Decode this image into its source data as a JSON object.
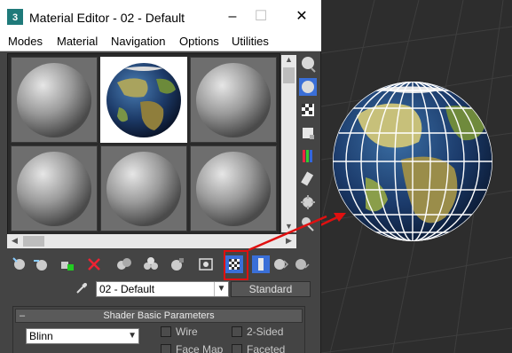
{
  "window": {
    "title": "Material Editor - 02 - Default",
    "controls": {
      "minimize": "–",
      "maximize": "☐",
      "close": "✕"
    }
  },
  "menu": {
    "items": [
      "Modes",
      "Material",
      "Navigation",
      "Options",
      "Utilities"
    ]
  },
  "slots": {
    "count": 6,
    "selected_index": 1,
    "selected_material": "earth-globe"
  },
  "name_row": {
    "material_name": "02 - Default",
    "material_type": "Standard"
  },
  "rollout": {
    "title": "Shader Basic Parameters",
    "collapse_symbol": "–",
    "shader": "Blinn",
    "checkboxes": [
      {
        "label": "Wire",
        "checked": false
      },
      {
        "label": "2-Sided",
        "checked": false
      },
      {
        "label": "Face Map",
        "checked": false
      },
      {
        "label": "Faceted",
        "checked": false
      }
    ]
  },
  "annotation": {
    "highlighted_button": "show-shaded-material-in-viewport-button",
    "color": "#e01010"
  },
  "colors": {
    "panel": "#444444",
    "viewport": "#2d2d2d",
    "accent": "#3a6fd8"
  }
}
